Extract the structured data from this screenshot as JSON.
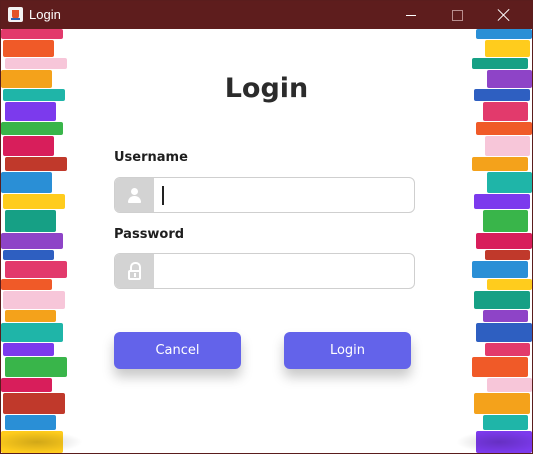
{
  "window": {
    "title": "Login",
    "controls": {
      "minimize": "minimize",
      "maximize": "maximize",
      "close": "close"
    },
    "accent": "#5e1d1d"
  },
  "form": {
    "heading": "Login",
    "username_label": "Username",
    "username_value": "",
    "password_label": "Password",
    "password_value": "",
    "cancel_label": "Cancel",
    "login_label": "Login",
    "button_color": "#6363ea",
    "icon_cell_color": "#d3d3d3"
  },
  "icons": [
    "java-app-icon",
    "user-icon",
    "lock-icon",
    "minimize-icon",
    "maximize-icon",
    "close-icon",
    "book-stack-decoration"
  ]
}
